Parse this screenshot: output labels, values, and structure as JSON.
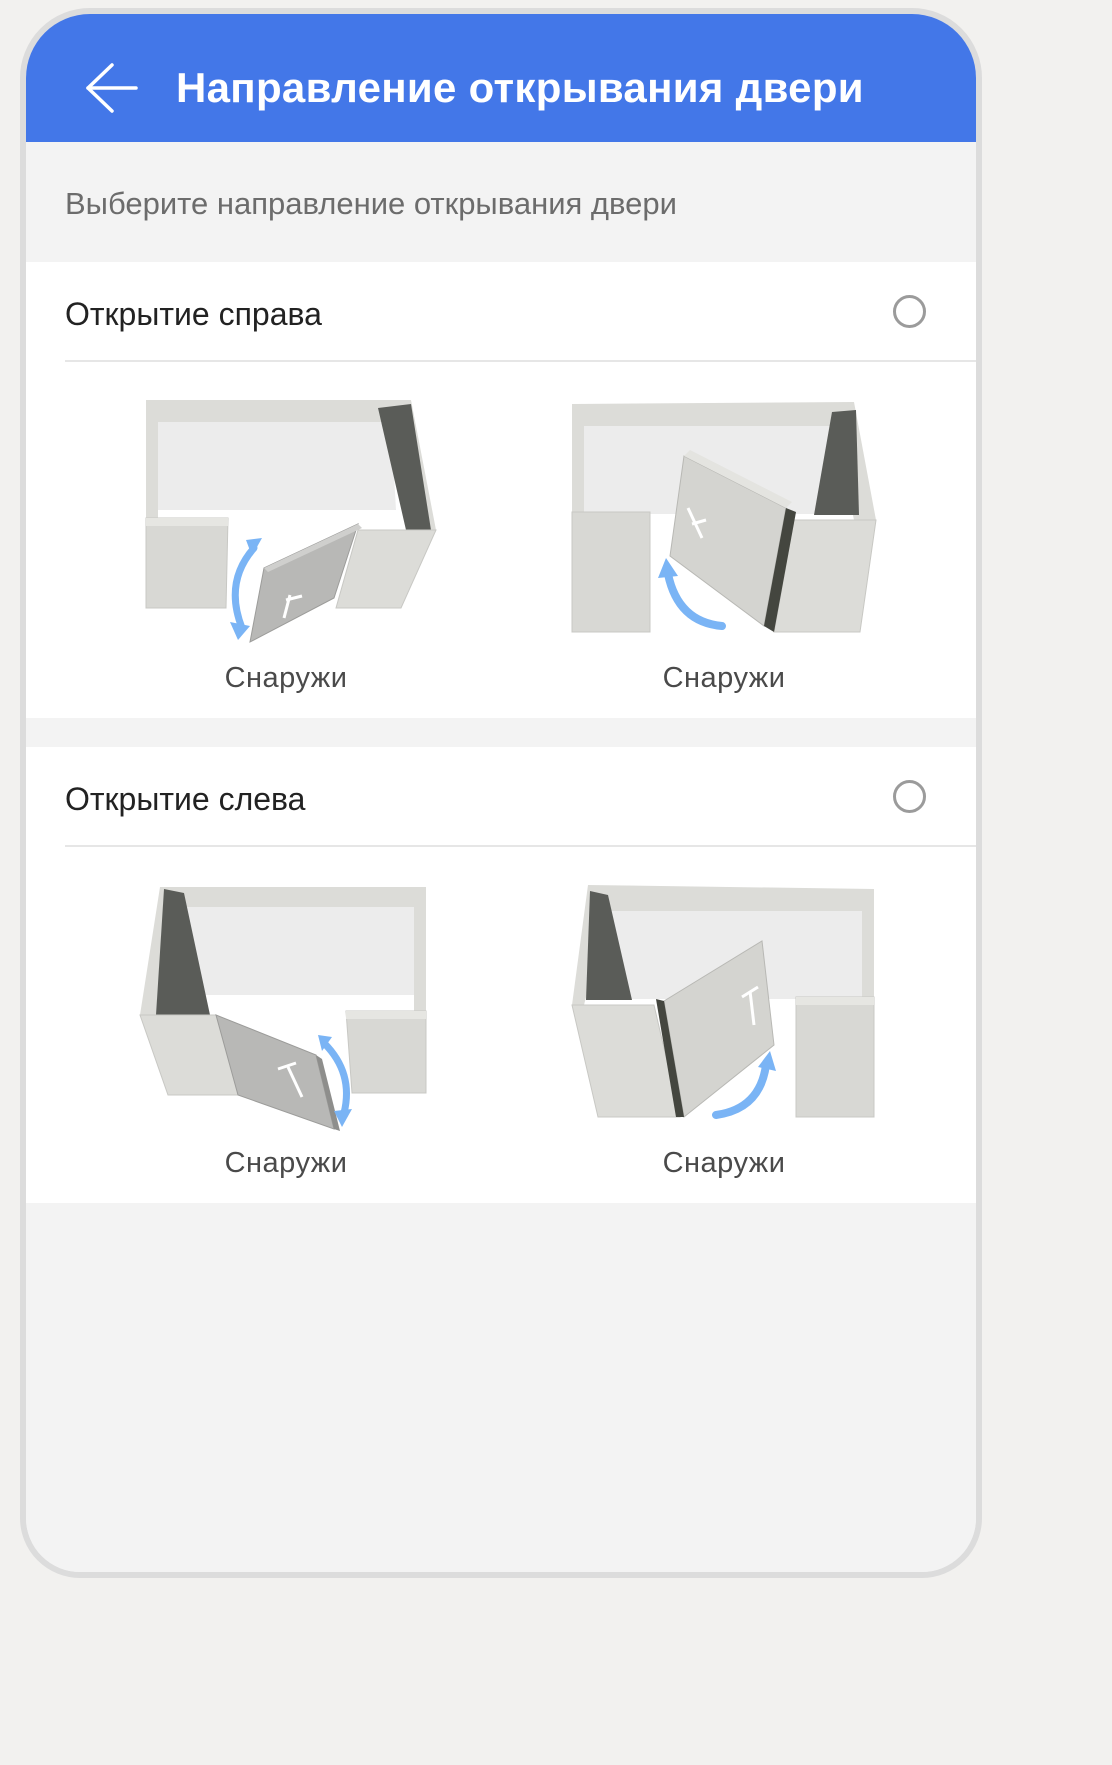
{
  "header": {
    "title": "Направление открывания двери",
    "back_icon": "arrow-left-icon"
  },
  "subtitle": "Выберите направление открывания двери",
  "sections": [
    {
      "label": "Открытие справа",
      "selected": false,
      "options": [
        {
          "label": "Снаружи"
        },
        {
          "label": "Снаружи"
        }
      ]
    },
    {
      "label": "Открытие слева",
      "selected": false,
      "options": [
        {
          "label": "Снаружи"
        },
        {
          "label": "Снаружи"
        }
      ]
    }
  ],
  "colors": {
    "header": "#4377e8",
    "arrow": "#7ab4f5",
    "wall": "#dcdcd8",
    "shadow": "#5a5c58"
  }
}
